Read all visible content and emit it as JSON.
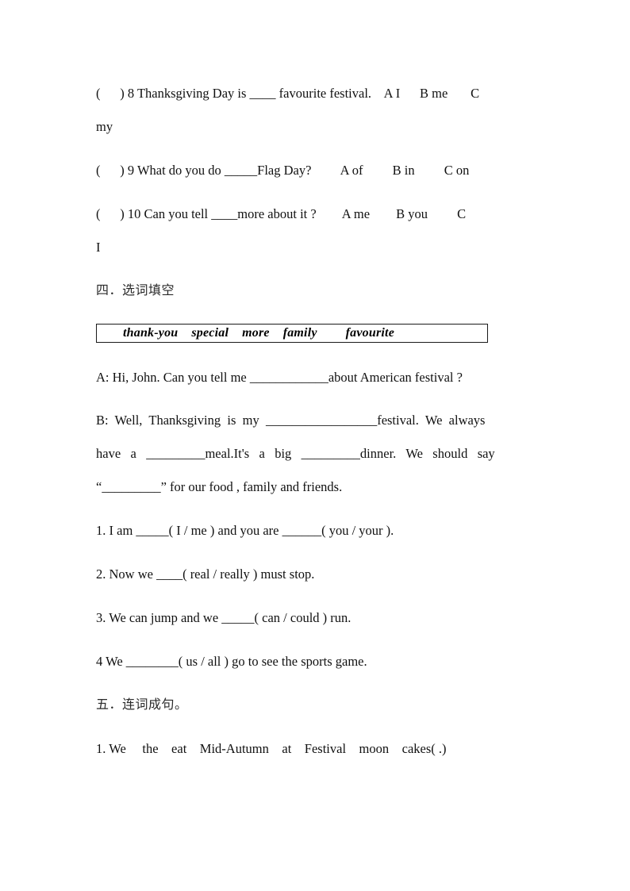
{
  "document": {
    "type": "english-worksheet",
    "language": "en-zh"
  },
  "multiple_choice": {
    "items": [
      {
        "bracket": "(      )",
        "number": "8",
        "stem": "Thanksgiving Day is ____ favourite festival.",
        "options": "A I      B me      C",
        "overflow": "my"
      },
      {
        "bracket": "(      )",
        "number": "9",
        "stem": "What do you do _____Flag Day?",
        "options": "A of        B in        C on",
        "overflow": ""
      },
      {
        "bracket": "(      )",
        "number": "10",
        "stem": "Can you tell ____more about it ?",
        "options": "A me       B you        C",
        "overflow": "I"
      }
    ],
    "line8": "(      ) 8 Thanksgiving Day is ____ favourite festival.    A I      B me       C",
    "line8_cont": "my",
    "line9": "(      ) 9 What do you do _____Flag Day?         A of         B in         C on",
    "line10": "(      ) 10 Can you tell ____more about it ?        A me        B you         C",
    "line10_cont": "I"
  },
  "section_four": {
    "heading": "四．选词填空",
    "word_bank": {
      "words": [
        "thank-you",
        "special",
        "more",
        "family",
        "favourite"
      ]
    },
    "dialogue": {
      "line_a": "A: Hi, John. Can you tell me ____________about American festival ?",
      "line_b_1": "B:  Well,  Thanksgiving  is  my  _________________festival.  We  always",
      "line_b_2": "have   a   _________meal.It's   a   big   _________dinner.   We   should   say",
      "line_b_3": "“_________” for our food , family and friends."
    },
    "choice_items": [
      "1. I am _____( I / me ) and you are ______( you / your ).",
      "2. Now we ____( real / really ) must stop.",
      "3. We can jump and we _____( can / could ) run.",
      "4 We ________( us / all ) go to see the sports game."
    ]
  },
  "section_five": {
    "heading": "五．连词成句。",
    "items": [
      "1. We     the    eat    Mid-Autumn    at    Festival    moon    cakes( .)"
    ]
  }
}
